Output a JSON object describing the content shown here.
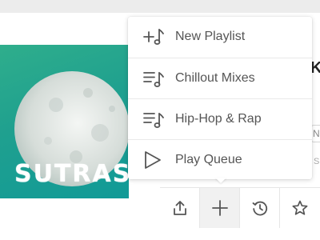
{
  "album": {
    "title": "SUTRAS"
  },
  "menu": {
    "items": [
      {
        "label": "New Playlist",
        "icon": "add-playlist-icon"
      },
      {
        "label": "Chillout Mixes",
        "icon": "playlist-icon"
      },
      {
        "label": "Hip-Hop & Rap",
        "icon": "playlist-icon"
      },
      {
        "label": "Play Queue",
        "icon": "play-icon"
      }
    ]
  },
  "toolbar": {
    "buttons": [
      {
        "icon": "share-icon"
      },
      {
        "icon": "plus-icon",
        "active": true
      },
      {
        "icon": "history-icon"
      },
      {
        "icon": "star-icon"
      }
    ]
  },
  "peek": {
    "heading_fragment": "K",
    "field_fragment": "N",
    "hint_fragment": "S"
  },
  "colors": {
    "album_gradient_start": "#2fae8c",
    "album_gradient_end": "#119a97",
    "menu_text": "#555555",
    "icon_stroke": "#555555"
  }
}
